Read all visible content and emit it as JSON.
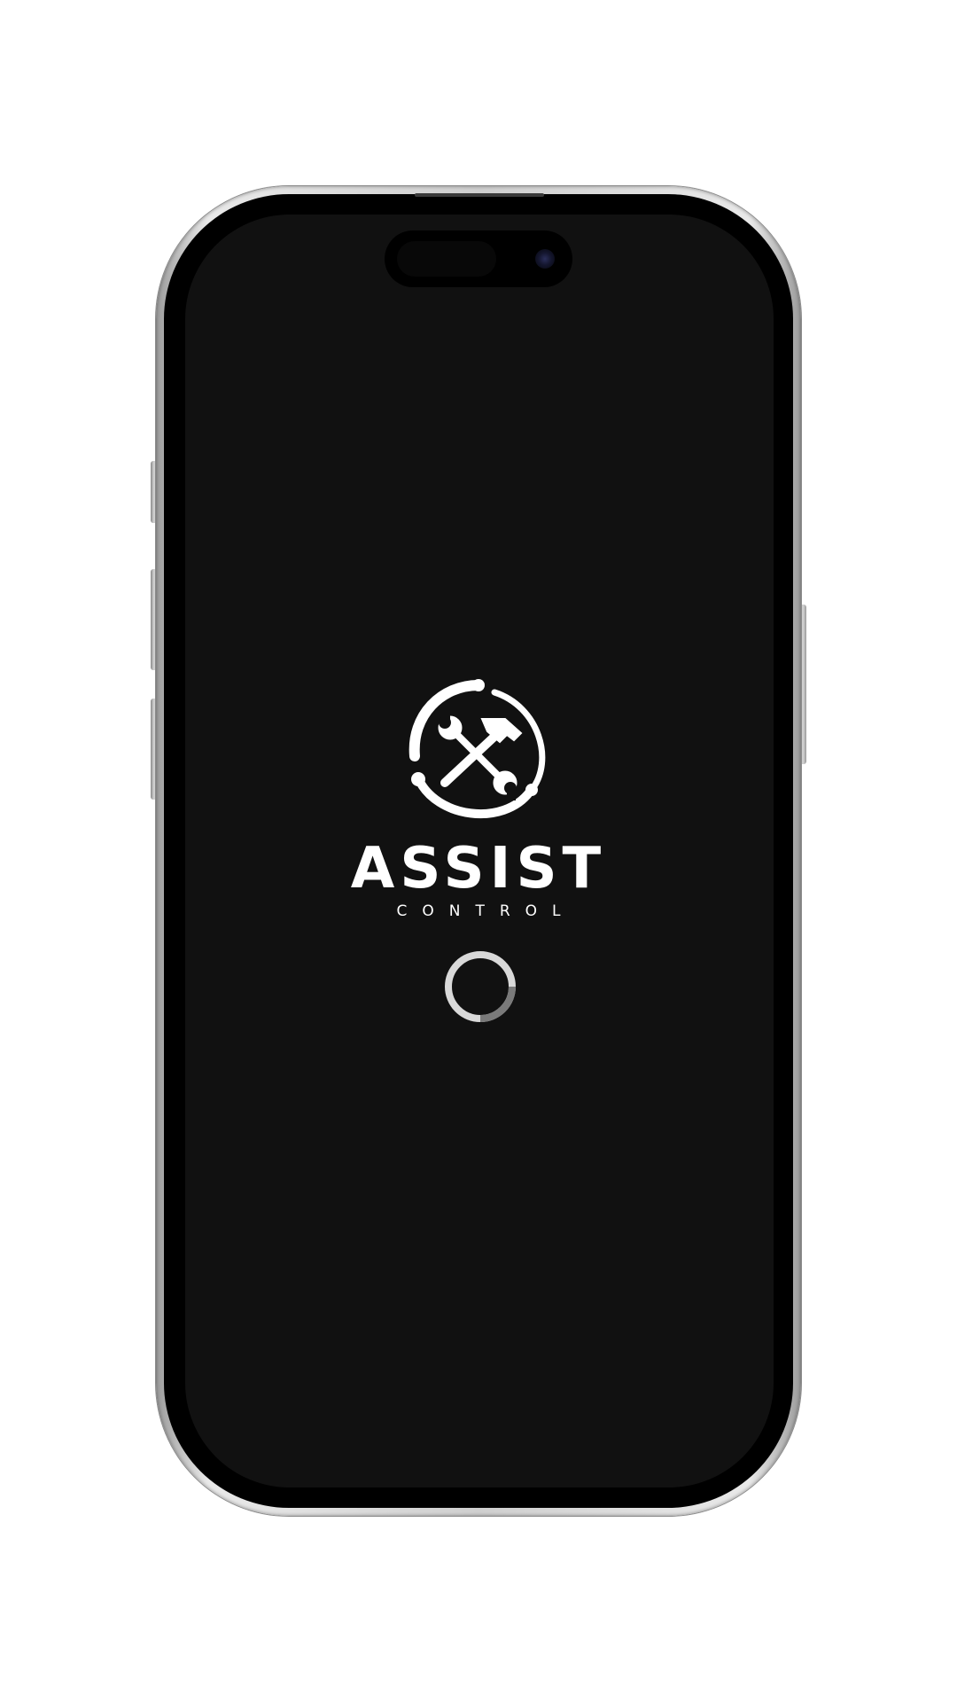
{
  "app": {
    "brand_name": "ASSIST",
    "brand_subtitle": "CONTROL"
  },
  "icons": {
    "logo": "tools-hammer-wrench-icon",
    "loader": "loading-spinner"
  },
  "colors": {
    "screen_background": "#111111",
    "logo": "#ffffff",
    "spinner_track": "#d9d9d9",
    "spinner_arc": "#7a7a7a"
  }
}
